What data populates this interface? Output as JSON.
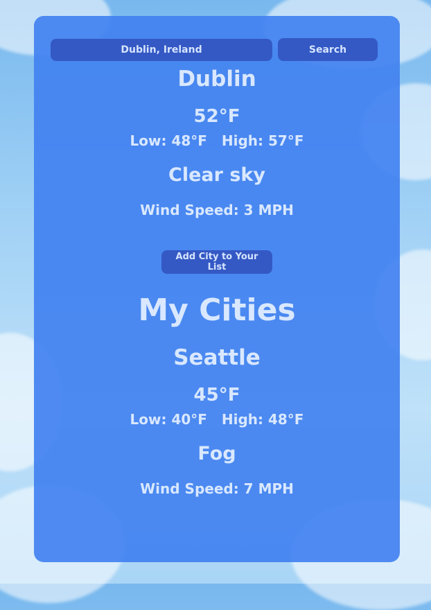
{
  "search": {
    "value": "Dublin, Ireland",
    "button_label": "Search"
  },
  "current": {
    "city": "Dublin",
    "temp": "52°F",
    "low": "Low: 48°F",
    "high": "High: 57°F",
    "condition": "Clear sky",
    "wind": "Wind Speed: 3 MPH"
  },
  "add_button_label": "Add City to Your List",
  "my_cities": {
    "title": "My Cities",
    "items": [
      {
        "city": "Seattle",
        "temp": "45°F",
        "low": "Low: 40°F",
        "high": "High: 48°F",
        "condition": "Fog",
        "wind": "Wind Speed: 7 MPH"
      }
    ]
  },
  "colors": {
    "panel": "#4382f0",
    "button": "#3459c4",
    "text": "#d9e8ff"
  }
}
